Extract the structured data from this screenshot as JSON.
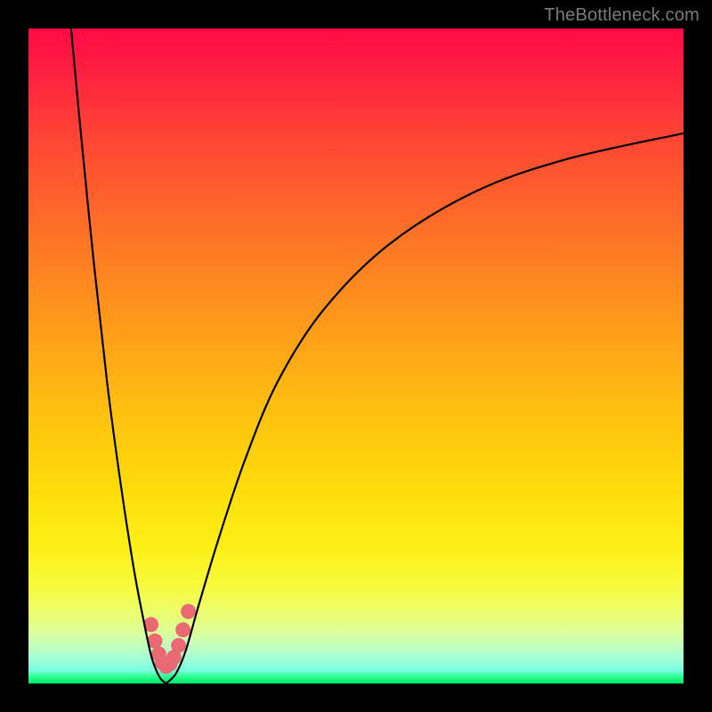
{
  "watermark": "TheBottleneck.com",
  "colors": {
    "frame": "#000000",
    "curve_stroke": "#000000",
    "marker_fill": "#e96a73",
    "watermark_text": "#7a7a7a"
  },
  "chart_data": {
    "type": "line",
    "title": "",
    "xlabel": "",
    "ylabel": "",
    "xlim": [
      0,
      100
    ],
    "ylim": [
      0,
      100
    ],
    "grid": false,
    "legend": false,
    "note": "Bottleneck-style V-curve. No axis ticks or labels are visible in the image; values are geometric estimates on a 0–100 normalized range.",
    "series": [
      {
        "name": "left-branch",
        "x": [
          6.5,
          8,
          10,
          12,
          14,
          16,
          17.5,
          18.8,
          20,
          21
        ],
        "values": [
          100,
          84,
          64,
          46,
          31,
          18,
          10,
          4,
          1,
          0
        ]
      },
      {
        "name": "right-branch",
        "x": [
          21,
          22.5,
          24,
          26,
          29,
          33,
          38,
          45,
          55,
          68,
          82,
          100
        ],
        "values": [
          0,
          1.5,
          5,
          12,
          22,
          34,
          46,
          57,
          67,
          75,
          80,
          84
        ]
      }
    ],
    "markers": {
      "name": "min-region-dots",
      "x": [
        18.7,
        19.3,
        19.9,
        20.4,
        21.0,
        21.6,
        22.2,
        22.9,
        23.6,
        24.4
      ],
      "values": [
        9.0,
        6.5,
        4.5,
        3.2,
        2.6,
        3.0,
        4.0,
        5.8,
        8.2,
        11.0
      ],
      "color": "#e96a73",
      "radius_pct": 1.15
    }
  }
}
